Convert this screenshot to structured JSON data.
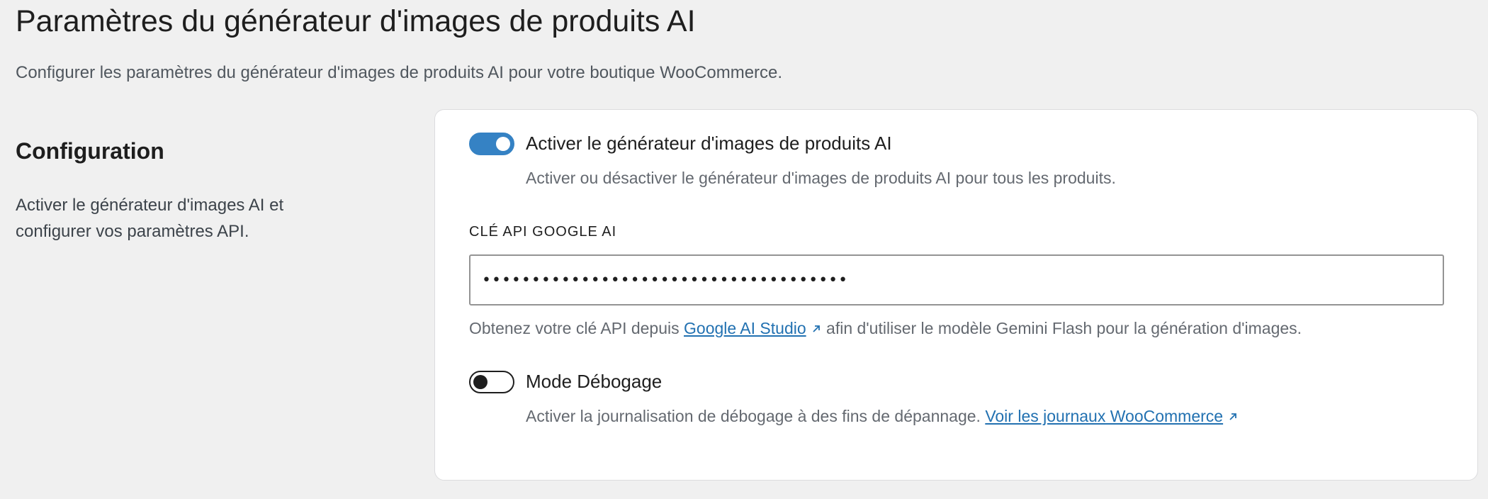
{
  "header": {
    "title": "Paramètres du générateur d'images de produits AI",
    "description": "Configurer les paramètres du générateur d'images de produits AI pour votre boutique WooCommerce."
  },
  "section": {
    "title": "Configuration",
    "description": "Activer le générateur d'images AI et configurer vos paramètres API."
  },
  "card": {
    "enable_toggle": {
      "label": "Activer le générateur d'images de produits AI",
      "checked": true,
      "help": "Activer ou désactiver le générateur d'images de produits AI pour tous les produits."
    },
    "api_key": {
      "label": "CLÉ API GOOGLE AI",
      "value": "•••••••••••••••••••••••••••••••••••••",
      "help_before": "Obtenez votre clé API depuis",
      "link_text": "Google AI Studio",
      "link_icon": "external-link-icon",
      "help_after": "afin d'utiliser le modèle Gemini Flash pour la génération d'images."
    },
    "debug_toggle": {
      "label": "Mode Débogage",
      "checked": false,
      "help_before": "Activer la journalisation de débogage à des fins de dépannage.",
      "link_text": "Voir les journaux WooCommerce",
      "link_icon": "external-link-icon"
    }
  },
  "colors": {
    "accent": "#3582c4",
    "link": "#2271b1",
    "background": "#f0f0f0",
    "card": "#ffffff"
  }
}
